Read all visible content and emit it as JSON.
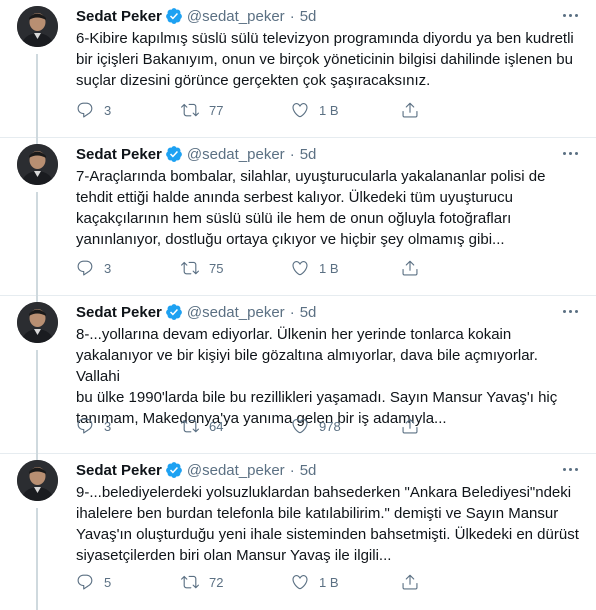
{
  "author": {
    "name": "Sedat Peker",
    "handle": "@sedat_peker",
    "dot": "·",
    "time": "5d"
  },
  "tweets": [
    {
      "text": "6-Kibire kapılmış süslü sülü televizyon programında diyordu ya ben kudretli\nbir içişleri Bakanıyım, onun ve birçok yöneticinin bilgisi dahilinde işlenen bu\nsuçlar dizesini görünce gerçekten çok şaşıracaksınız.",
      "replies": "3",
      "retweets": "77",
      "likes": "1 B"
    },
    {
      "text": "7-Araçlarında bombalar, silahlar, uyuşturucularla yakalananlar polisi de\ntehdit ettiği halde anında serbest kalıyor. Ülkedeki tüm uyuşturucu\nkaçakçılarının hem süslü sülü ile hem de onun oğluyla fotoğrafları\nyanınlanıyor, dostluğu ortaya çıkıyor ve hiçbir şey olmamış gibi...",
      "replies": "3",
      "retweets": "75",
      "likes": "1 B"
    },
    {
      "text": "8-...yollarına devam ediyorlar. Ülkenin her yerinde tonlarca kokain\nyakalanıyor ve bir kişiyi bile gözaltına almıyorlar, dava bile açmıyorlar. Vallahi\nbu ülke 1990'larda bile bu rezillikleri yaşamadı. Sayın Mansur Yavaş'ı hiç\ntanımam, Makedonya'ya yanıma gelen bir iş adamıyla...",
      "replies": "3",
      "retweets": "64",
      "likes": "978"
    },
    {
      "text": "9-...belediyelerdeki yolsuzluklardan bahsederken \"Ankara Belediyesi\"ndeki\nihalelere ben burdan telefonla bile katılabilirim.\" demişti ve Sayın Mansur\nYavaş'ın oluşturduğu yeni ihale sisteminden bahsetmişti. Ülkedeki en dürüst\nsiyasetçilerden biri olan Mansur Yavaş ile ilgili...",
      "replies": "5",
      "retweets": "72",
      "likes": "1 B"
    }
  ],
  "colors": {
    "text": "#0f1419",
    "muted": "#5b7083",
    "verified": "#1da1f2",
    "divider": "#e6ecf0",
    "thread_line": "#cfd9de"
  },
  "icons": [
    "verified-badge-icon",
    "more-icon",
    "reply-icon",
    "retweet-icon",
    "like-icon",
    "share-icon"
  ]
}
